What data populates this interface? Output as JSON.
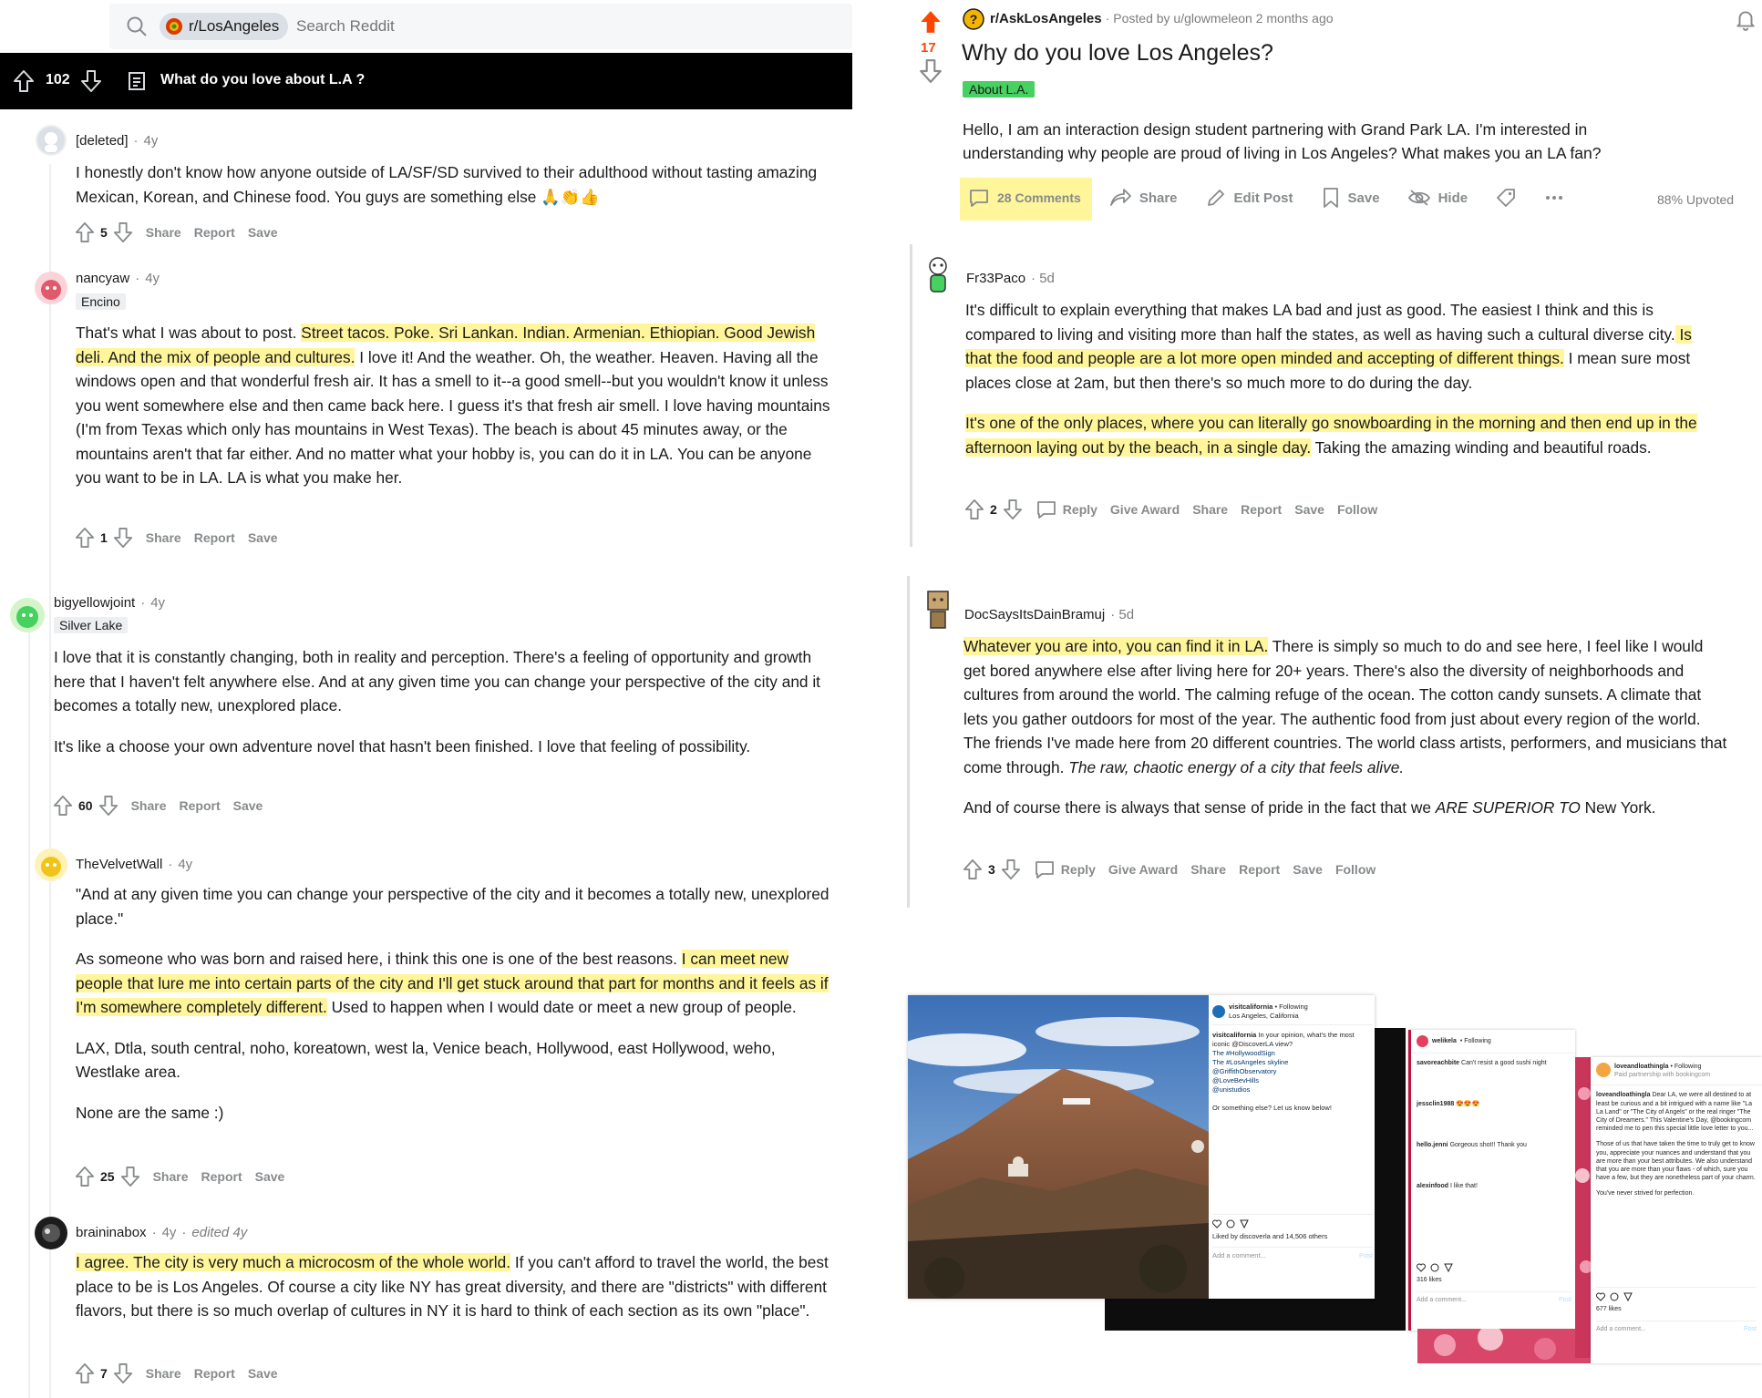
{
  "search": {
    "subreddit": "r/LosAngeles",
    "placeholder": "Search Reddit"
  },
  "postbar": {
    "score": "102",
    "title": "What do you love about L.A ?"
  },
  "left_comments": [
    {
      "user": "[deleted]",
      "age": "4y",
      "text": "I honestly don't know how anyone outside of LA/SF/SD survived to their adulthood without tasting amazing Mexican, Korean, and Chinese food. You guys are something else 🙏👏👍",
      "score": "5"
    },
    {
      "user": "nancyaw",
      "age": "4y",
      "flair": "Encino",
      "text_pre": "That's what I was about to post. ",
      "text_hl": "Street tacos. Poke. Sri Lankan. Indian. Armenian. Ethiopian. Good Jewish deli. And the mix of people and cultures.",
      "text_post": " I love it! And the weather. Oh, the weather. Heaven. Having all the windows open and that wonderful fresh air. It has a smell to it--a good smell--but you wouldn't know it unless you went somewhere else and then came back here. I guess it's that fresh air smell. I love having mountains (I'm from Texas which only has mountains in West Texas). The beach is about 45 minutes away, or the mountains aren't that far either. And no matter what your hobby is, you can do it in LA. You can be anyone you want to be in LA. LA is what you make her.",
      "score": "1"
    },
    {
      "user": "bigyellowjoint",
      "age": "4y",
      "flair": "Silver Lake",
      "p1": "I love that it is constantly changing, both in reality and perception. There's a feeling of opportunity and growth here that I haven't felt anywhere else. And at any given time you can change your perspective of the city and it becomes a totally new, unexplored place.",
      "p2": "It's like a choose your own adventure novel that hasn't been finished. I love that feeling of possibility.",
      "score": "60"
    },
    {
      "user": "TheVelvetWall",
      "age": "4y",
      "p1": "\"And at any given time you can change your perspective of the city and it becomes a totally new, unexplored place.\"",
      "p2_pre": "As someone who was born and raised here, i think this one is one of the best reasons. ",
      "p2_hl": "I can meet new people that lure me into certain parts of the city and I'll get stuck around that part for months and it feels as if I'm somewhere completely different.",
      "p2_post": " Used to happen when I would date or meet a new group of people.",
      "p3": "LAX, Dtla, south central, noho, koreatown, west la, Venice beach, Hollywood, east Hollywood, weho, Westlake area.",
      "p4": "None are the same :)",
      "score": "25"
    },
    {
      "user": "braininabox",
      "age": "4y",
      "edited": "edited 4y",
      "text_hl": "I agree. The city is very much a microcosm of the whole world.",
      "text_post": " If you can't afford to travel the world, the best place to be is Los Angeles. Of course a city like NY has great diversity, and there are \"districts\" with different flavors, but there is so much overlap of cultures in NY it is hard to think of each section as its own \"place\".",
      "score": "7"
    }
  ],
  "actions": {
    "share": "Share",
    "report": "Report",
    "save": "Save",
    "reply": "Reply",
    "give_award": "Give Award",
    "follow": "Follow"
  },
  "right_post": {
    "subreddit": "r/AskLosAngeles",
    "posted_by": "· Posted by u/glowmeleon 2 months ago",
    "score": "17",
    "title": "Why do you love Los Angeles?",
    "flair": "About L.A.",
    "body": "Hello, I am an interaction design student partnering with Grand Park LA. I'm interested in understanding why people are proud of living in Los Angeles? What makes you an LA fan?",
    "comments": "28 Comments",
    "share": "Share",
    "edit": "Edit Post",
    "save": "Save",
    "hide": "Hide",
    "upvoted": "88% Upvoted"
  },
  "right_comments": [
    {
      "user": "Fr33Paco",
      "age": "· 5d",
      "p1_pre": "It's difficult to explain everything that makes LA bad and just as good. The easiest I think and this is compared to living and visiting more than half the states, as well as having such a cultural diverse city.",
      "p1_hl": " Is that the food and people are a lot more open minded and accepting of different things.",
      "p1_post": " I mean sure most places close at 2am, but then there's so much more to do during the day.",
      "p2_hl": "It's one of the only places, where you can literally go snowboarding in the morning and then end up in the afternoon laying out by the beach, in a single day.",
      "p2_post": " Taking the amazing winding and beautiful roads.",
      "score": "2"
    },
    {
      "user": "DocSaysItsDainBramuj",
      "age": "· 5d",
      "p1_hl": "Whatever you are into, you can find it in LA.",
      "p1_post": " There is simply so much to do and see here, I feel like I would get bored anywhere else after living here for 20+ years. There's also the diversity of neighborhoods and cultures from around the world. The calming refuge of the ocean. The cotton candy sunsets. A climate that lets you gather outdoors for most of the year. The authentic food from just about every region of the world. The friends I've made here from 20 different countries. The world class artists, performers, and musicians that come through. ",
      "p1_it": "The raw, chaotic energy of a city that feels alive.",
      "p2_pre": "And of course there is always that sense of pride in the fact that we ",
      "p2_it": "ARE SUPERIOR TO",
      "p2_post": " New York.",
      "score": "3"
    }
  ],
  "instagram": [
    {
      "account": "visitcalifornia",
      "following": "• Following",
      "location": "Los Angeles, California",
      "caption": "In your opinion, what's the most iconic @DiscoverLA view?",
      "tags": [
        "The #HollywoodSign",
        "The #LosAngeles skyline",
        "@GriffithObservatory",
        "@LoveBevHills",
        "@unistudios"
      ],
      "extra": "Or something else? Let us know below!",
      "likes": "Liked by discoverla and 14,506 others",
      "add": "Add a comment...",
      "post": "Post"
    },
    {
      "account": "welikela",
      "following": "• Following",
      "c1_user": "savoreachbite",
      "c1_text": "Can't resist a good sushi night",
      "c2_user": "jessclin1988",
      "c3_user": "hello.jenni",
      "c3_text": "Gorgeous shot!! Thank you",
      "c4_user": "alexinfood",
      "c4_text": "I like that!",
      "likes": "316 likes",
      "add": "Add a comment...",
      "post": "Post"
    },
    {
      "account": "loveandloathingla",
      "following": "• Following",
      "sub": "Paid partnership with bookingcom",
      "caption": "Dear LA, we were all destined to at least be curious and a bit intrigued with a name like \"La La Land\" or \"The City of Angels\" or the real ringer \"The City of Dreamers.\" This Valentine's Day, @bookingcom reminded me to pen this special little love letter to you...",
      "caption2": "Those of us that have taken the time to truly get to know you, appreciate your nuances and understand that you are more than your best attributes. We also understand that you are more than your flaws - of which, sure you have a few, but they are nonetheless part of your charm.",
      "caption3": "You've never strived for perfection.",
      "likes": "677 likes",
      "add": "Add a comment...",
      "post": "Post"
    }
  ],
  "colors": {
    "highlight": "#fff59a",
    "upvote": "#ff4500",
    "flair_green": "#46d160",
    "meta_gray": "#878a8c"
  }
}
